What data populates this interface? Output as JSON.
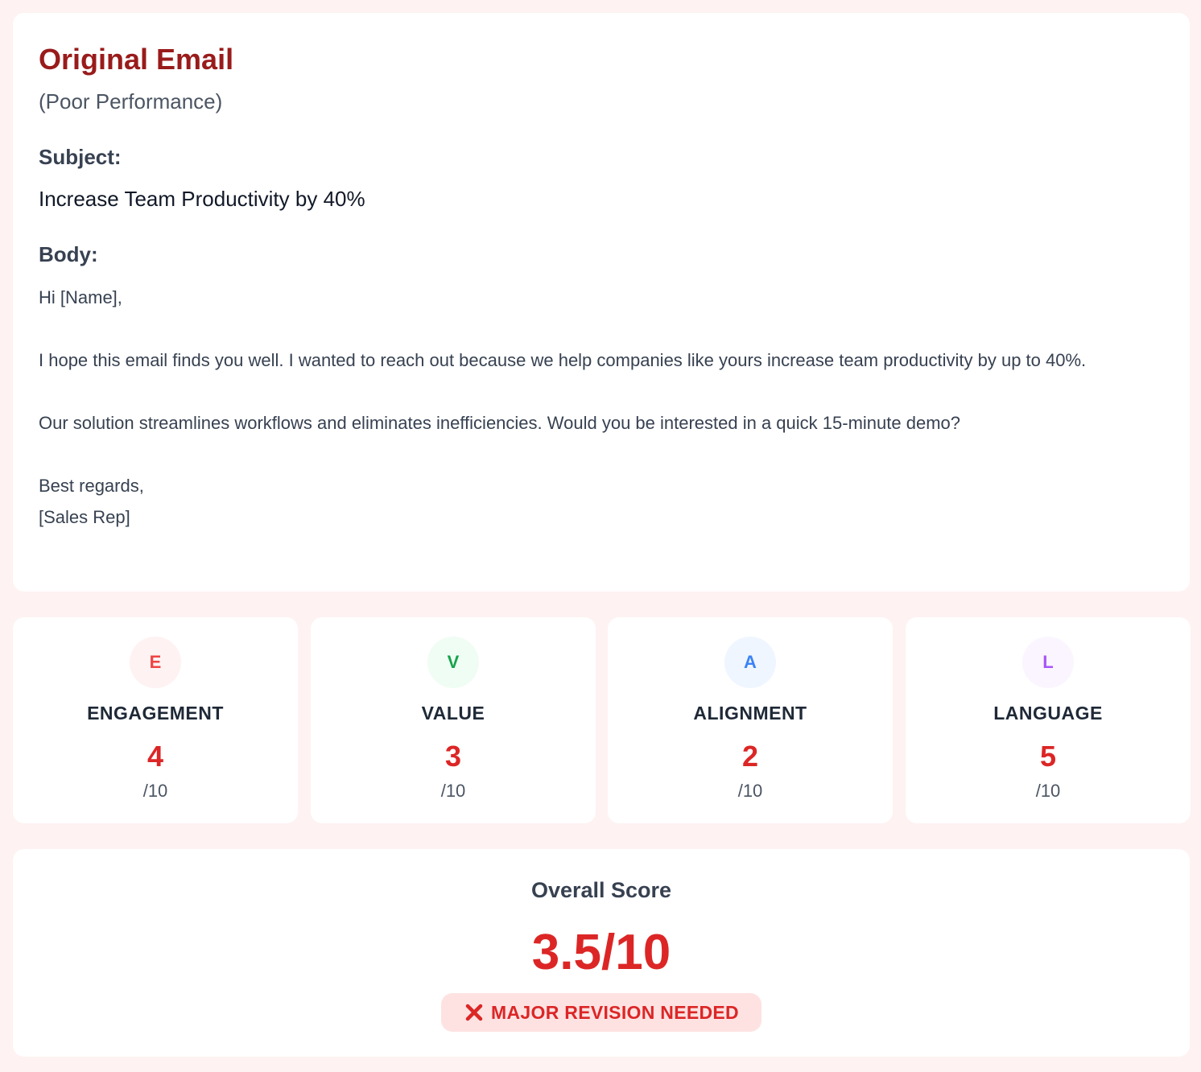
{
  "email": {
    "title": "Original Email",
    "subtitle": "(Poor Performance)",
    "subject_label": "Subject:",
    "subject": "Increase Team Productivity by 40%",
    "body_label": "Body:",
    "body": {
      "greeting": "Hi [Name],",
      "paragraph1": "I hope this email finds you well. I wanted to reach out because we help companies like yours increase team productivity by up to 40%.",
      "paragraph2": "Our solution streamlines workflows and eliminates inefficiencies. Would you be interested in a quick 15-minute demo?",
      "signoff": "Best regards,",
      "signature": "[Sales Rep]"
    }
  },
  "metrics": [
    {
      "letter": "E",
      "name": "ENGAGEMENT",
      "score": "4",
      "max": "/10",
      "color": "#ef4444"
    },
    {
      "letter": "V",
      "name": "VALUE",
      "score": "3",
      "max": "/10",
      "color": "#16a34a"
    },
    {
      "letter": "A",
      "name": "ALIGNMENT",
      "score": "2",
      "max": "/10",
      "color": "#3b82f6"
    },
    {
      "letter": "L",
      "name": "LANGUAGE",
      "score": "5",
      "max": "/10",
      "color": "#a855f7"
    }
  ],
  "overall": {
    "label": "Overall Score",
    "score": "3.5/10",
    "status": "MAJOR REVISION NEEDED",
    "status_icon": "x-icon",
    "accent_color": "#dc2626"
  }
}
